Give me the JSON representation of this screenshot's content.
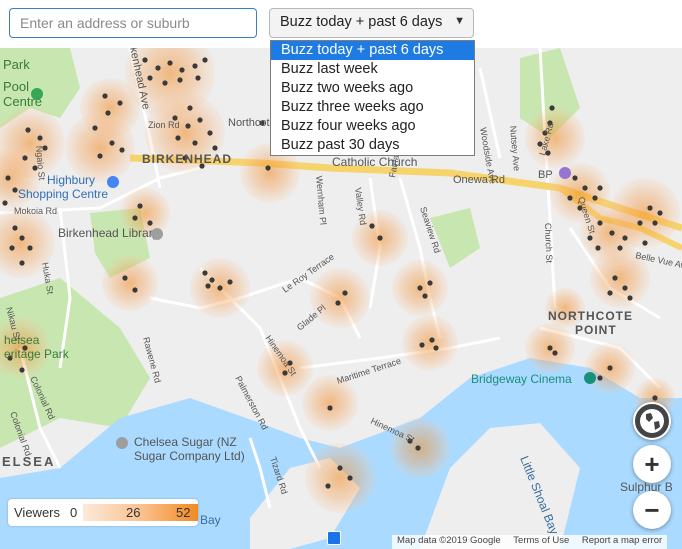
{
  "search": {
    "placeholder": "Enter an address or suburb"
  },
  "period": {
    "selected": "Buzz today + past 6 days",
    "options": [
      "Buzz today + past 6 days",
      "Buzz last week",
      "Buzz two weeks ago",
      "Buzz three weeks ago",
      "Buzz four weeks ago",
      "Buzz past 30 days"
    ]
  },
  "map": {
    "labels": {
      "park": "Park",
      "pool1": "Pool",
      "pool2": "Centre",
      "highbury1": "Highbury",
      "highbury2": "Shopping Centre",
      "library": "Birkenhead Library",
      "birkenhead": "BIRKENHEAD",
      "catholic": "Catholic Church",
      "onewa": "Onewa Rd",
      "bp": "BP",
      "northcote_point1": "NORTHCOTE",
      "northcote_point2": "POINT",
      "northcote": "Northcote",
      "bridgeway": "Bridgeway Cinema",
      "chelsea_sugar1": "Chelsea Sugar (NZ",
      "chelsea_sugar2": "Sugar Company Ltd)",
      "chelsea": "ELSEA",
      "chelsea_park1": "helsea",
      "chelsea_park2": "eritage Park",
      "little_shoal": "Little Shoal Bay",
      "sulphur": "Sulphur B",
      "bay": "a Bay",
      "mokoia": "Mokoia Rd",
      "huka": "Huka St",
      "maritime": "Maritime Terrace",
      "hinemoa": "Hinemoa St",
      "palmerston": "Palmerston Rd",
      "le_roy": "Le Roy Terrace",
      "glade": "Glade Pl",
      "queen": "Queen St",
      "church": "Church St",
      "belle_vue": "Belle Vue Ave",
      "lake": "Lake Rd",
      "woodside": "Woodside Ave",
      "nutsey": "Nutsey Ave",
      "fairfax": "Fairfax Ave",
      "valley": "Valley Rd",
      "wernham": "Wernham Pl",
      "seaview": "Seaview Rd",
      "colonial": "Colonial Rd",
      "rawene": "Rawene Rd",
      "tizard": "Tizard Rd",
      "kenhead_ave": "kenhead Ave",
      "zion": "Zion Rd",
      "nikau": "Nikau St",
      "ngaio": "Ngaio St"
    }
  },
  "legend": {
    "title": "Viewers",
    "min": "0",
    "mid": "26",
    "max": "52"
  },
  "attribution": {
    "data": "Map data ©2019 Google",
    "terms": "Terms of Use",
    "report": "Report a map error"
  },
  "controls": {
    "zoom_in": "+",
    "zoom_out": "−"
  },
  "colors": {
    "heat": "#f28a22",
    "water": "#aadaff",
    "park": "#c8e6b0",
    "land": "#eeeeee",
    "road_major": "#f6d36b"
  }
}
